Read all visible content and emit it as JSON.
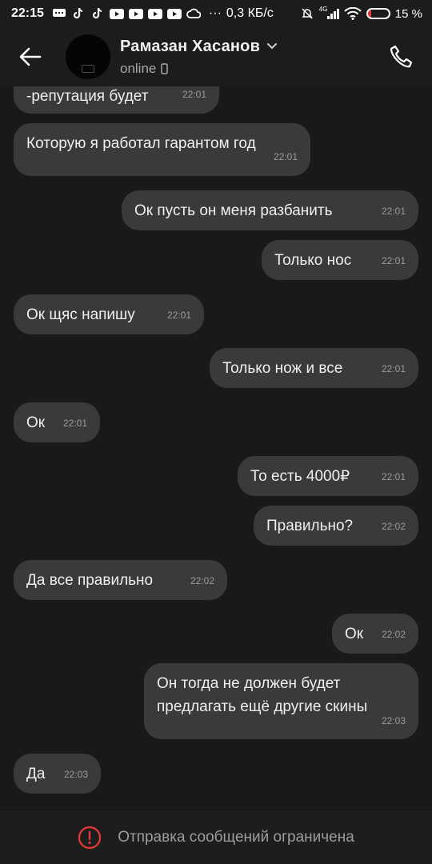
{
  "status_bar": {
    "time": "22:15",
    "dots": "···",
    "net_speed": "0,3 КБ/с",
    "network_label": "4G",
    "battery": "15 %",
    "battery_level": 0.15,
    "battery_color": "#e53935",
    "icons": [
      "chat-icon",
      "tiktok-icon",
      "tiktok-icon",
      "youtube-icon",
      "youtube-icon",
      "youtube-icon",
      "youtube-icon",
      "cloud-icon"
    ]
  },
  "header": {
    "contact_name": "Рамазан Хасанов",
    "status": "online",
    "back_icon": "arrow-left-icon",
    "call_icon": "phone-icon"
  },
  "messages": [
    {
      "side": "in",
      "text": "-репутация будет",
      "time": "22:01"
    },
    {
      "side": "in",
      "text": "Которую я работал гарантом год",
      "time": "22:01"
    },
    {
      "side": "out",
      "text": "Ок пусть он меня разбанить",
      "time": "22:01"
    },
    {
      "side": "out",
      "text": "Только нос",
      "time": "22:01"
    },
    {
      "side": "in",
      "text": "Ок щяс напишу",
      "time": "22:01"
    },
    {
      "side": "out",
      "text": "Только нож и все",
      "time": "22:01"
    },
    {
      "side": "in",
      "text": "Ок",
      "time": "22:01"
    },
    {
      "side": "out",
      "text": "То есть 4000₽",
      "time": "22:01"
    },
    {
      "side": "out",
      "text": "Правильно?",
      "time": "22:02"
    },
    {
      "side": "in",
      "text": "Да все правильно",
      "time": "22:02"
    },
    {
      "side": "out",
      "text": "Ок",
      "time": "22:02"
    },
    {
      "side": "out",
      "text": "Он тогда не должен будет предлагать ещё другие скины",
      "time": "22:03"
    },
    {
      "side": "in",
      "text": "Да",
      "time": "22:03"
    }
  ],
  "footer": {
    "restriction_text": "Отправка сообщений ограничена",
    "icon": "alert-circle-icon",
    "icon_color": "#e53935"
  },
  "colors": {
    "background": "#191919",
    "bubble": "#3a3a3a"
  }
}
